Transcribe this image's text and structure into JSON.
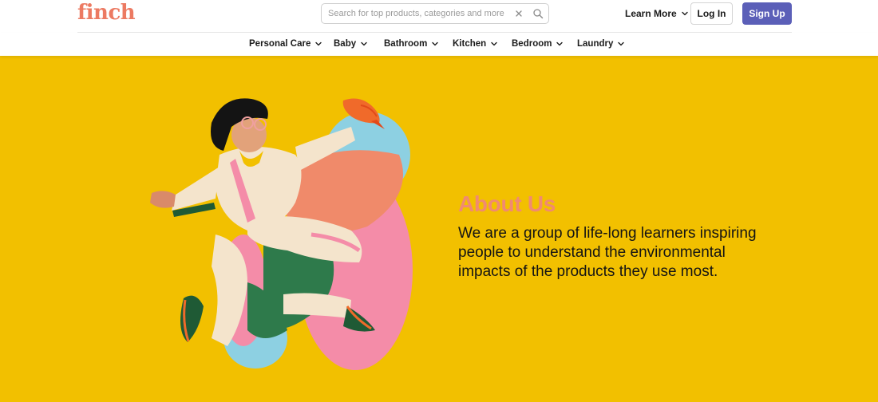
{
  "brand": {
    "logo_text": "finch",
    "logo_color": "#ec7a62"
  },
  "search": {
    "placeholder": "Search for top products, categories and more",
    "value": ""
  },
  "header": {
    "learn_more_label": "Learn More",
    "login_label": "Log In",
    "signup_label": "Sign Up",
    "signup_color": "#5b5fb8"
  },
  "nav": {
    "categories": [
      {
        "label": "Personal Care"
      },
      {
        "label": "Baby"
      },
      {
        "label": "Bathroom"
      },
      {
        "label": "Kitchen"
      },
      {
        "label": "Bedroom"
      },
      {
        "label": "Laundry"
      }
    ]
  },
  "hero": {
    "background_color": "#f2c000",
    "title": "About Us",
    "title_color": "#f08a72",
    "text": "We are a group of life-long learners inspiring people to understand the environmental impacts of the products they use most.",
    "illustration": "person-with-bird-illustration"
  },
  "icons": {
    "clear": "close-icon",
    "search": "search-icon",
    "dropdown": "chevron-down-icon"
  }
}
